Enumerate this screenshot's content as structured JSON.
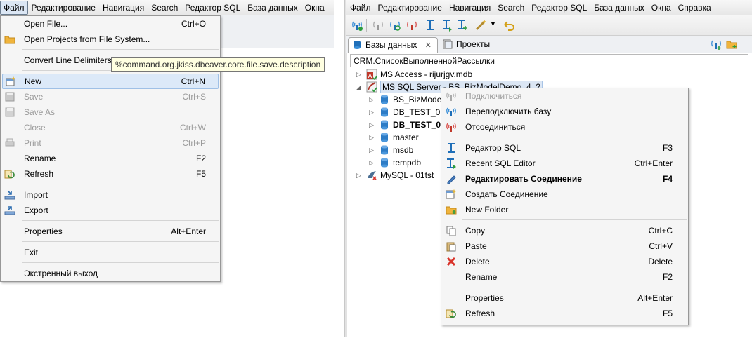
{
  "left": {
    "menubar": [
      "Файл",
      "Редактирование",
      "Навигация",
      "Search",
      "Редактор SQL",
      "База данных",
      "Окна"
    ],
    "file_menu": [
      {
        "label": "Open File...",
        "shortcut": "Ctrl+O",
        "icon": "none"
      },
      {
        "label": "Open Projects from File System...",
        "shortcut": "",
        "icon": "folder-icon"
      },
      {
        "sep": true
      },
      {
        "label": "Convert Line Delimiters",
        "shortcut": "",
        "icon": "none"
      },
      {
        "sep": true
      },
      {
        "label": "New",
        "shortcut": "Ctrl+N",
        "icon": "new-icon",
        "highlighted": true
      },
      {
        "label": "Save",
        "shortcut": "Ctrl+S",
        "icon": "save-icon",
        "disabled": true
      },
      {
        "label": "Save As",
        "shortcut": "",
        "icon": "save-as-icon",
        "disabled": true
      },
      {
        "label": "Close",
        "shortcut": "Ctrl+W",
        "icon": "none",
        "disabled": true
      },
      {
        "label": "Print",
        "shortcut": "Ctrl+P",
        "icon": "print-icon",
        "disabled": true
      },
      {
        "label": "Rename",
        "shortcut": "F2",
        "icon": "none"
      },
      {
        "label": "Refresh",
        "shortcut": "F5",
        "icon": "refresh-icon"
      },
      {
        "sep": true
      },
      {
        "label": "Import",
        "shortcut": "",
        "icon": "import-icon"
      },
      {
        "label": "Export",
        "shortcut": "",
        "icon": "export-icon"
      },
      {
        "sep": true
      },
      {
        "label": "Properties",
        "shortcut": "Alt+Enter",
        "icon": "none"
      },
      {
        "sep": true
      },
      {
        "label": "Exit",
        "shortcut": "",
        "icon": "none"
      },
      {
        "sep": true
      },
      {
        "label": "Экстренный выход",
        "shortcut": "",
        "icon": "none"
      }
    ],
    "tooltip": "%command.org.jkiss.dbeaver.core.file.save.description"
  },
  "right": {
    "menubar": [
      "Файл",
      "Редактирование",
      "Навигация",
      "Search",
      "Редактор SQL",
      "База данных",
      "Окна",
      "Справка"
    ],
    "tabs": [
      {
        "label": "Базы данных",
        "close": "✕",
        "active": true
      },
      {
        "label": "Проекты",
        "active": false
      }
    ],
    "breadcrumb": "CRM.СписокВыполненнойРассылки",
    "tree": [
      {
        "label": "MS Access - rijurjgv.mdb",
        "toggle": "▷",
        "depth": 0,
        "icon": "access-icon"
      },
      {
        "label": "MS SQL Server - BS_BizModelDemo_4_2",
        "toggle": "◢",
        "depth": 0,
        "icon": "mssql-icon",
        "selected": true
      },
      {
        "label": "BS_BizModel",
        "toggle": "▷",
        "depth": 1,
        "icon": "database-icon"
      },
      {
        "label": "DB_TEST_01",
        "toggle": "▷",
        "depth": 1,
        "icon": "database-icon"
      },
      {
        "label": "DB_TEST_02",
        "toggle": "▷",
        "depth": 1,
        "icon": "database-icon",
        "bold": true
      },
      {
        "label": "master",
        "toggle": "▷",
        "depth": 1,
        "icon": "database-icon"
      },
      {
        "label": "msdb",
        "toggle": "▷",
        "depth": 1,
        "icon": "database-icon"
      },
      {
        "label": "tempdb",
        "toggle": "▷",
        "depth": 1,
        "icon": "database-icon"
      },
      {
        "label": "MySQL - 01tst",
        "toggle": "▷",
        "depth": 0,
        "icon": "mysql-icon"
      }
    ],
    "context_menu": [
      {
        "label": "Подключиться",
        "shortcut": "",
        "icon": "connect-icon",
        "disabled": true
      },
      {
        "label": "Переподключить базу",
        "shortcut": "",
        "icon": "reconnect-icon"
      },
      {
        "label": "Отсоединиться",
        "shortcut": "",
        "icon": "disconnect-icon"
      },
      {
        "sep": true
      },
      {
        "label": "Редактор SQL",
        "shortcut": "F3",
        "icon": "sql-editor-icon"
      },
      {
        "label": "Recent SQL Editor",
        "shortcut": "Ctrl+Enter",
        "icon": "recent-sql-icon"
      },
      {
        "label": "Редактировать Соединение",
        "shortcut": "F4",
        "icon": "pencil-icon",
        "bold": true
      },
      {
        "label": "Создать Соединение",
        "shortcut": "",
        "icon": "new-connection-icon"
      },
      {
        "label": "New Folder",
        "shortcut": "",
        "icon": "new-folder-icon"
      },
      {
        "sep": true
      },
      {
        "label": "Copy",
        "shortcut": "Ctrl+C",
        "icon": "copy-icon"
      },
      {
        "label": "Paste",
        "shortcut": "Ctrl+V",
        "icon": "paste-icon"
      },
      {
        "label": "Delete",
        "shortcut": "Delete",
        "icon": "delete-icon"
      },
      {
        "label": "Rename",
        "shortcut": "F2",
        "icon": "none"
      },
      {
        "sep": true
      },
      {
        "label": "Properties",
        "shortcut": "Alt+Enter",
        "icon": "none"
      },
      {
        "label": "Refresh",
        "shortcut": "F5",
        "icon": "refresh-icon"
      }
    ]
  },
  "colors": {
    "highlight": "#dce9f8",
    "disabled": "#9b9b9b",
    "menu_bg": "#f5f5f5"
  }
}
